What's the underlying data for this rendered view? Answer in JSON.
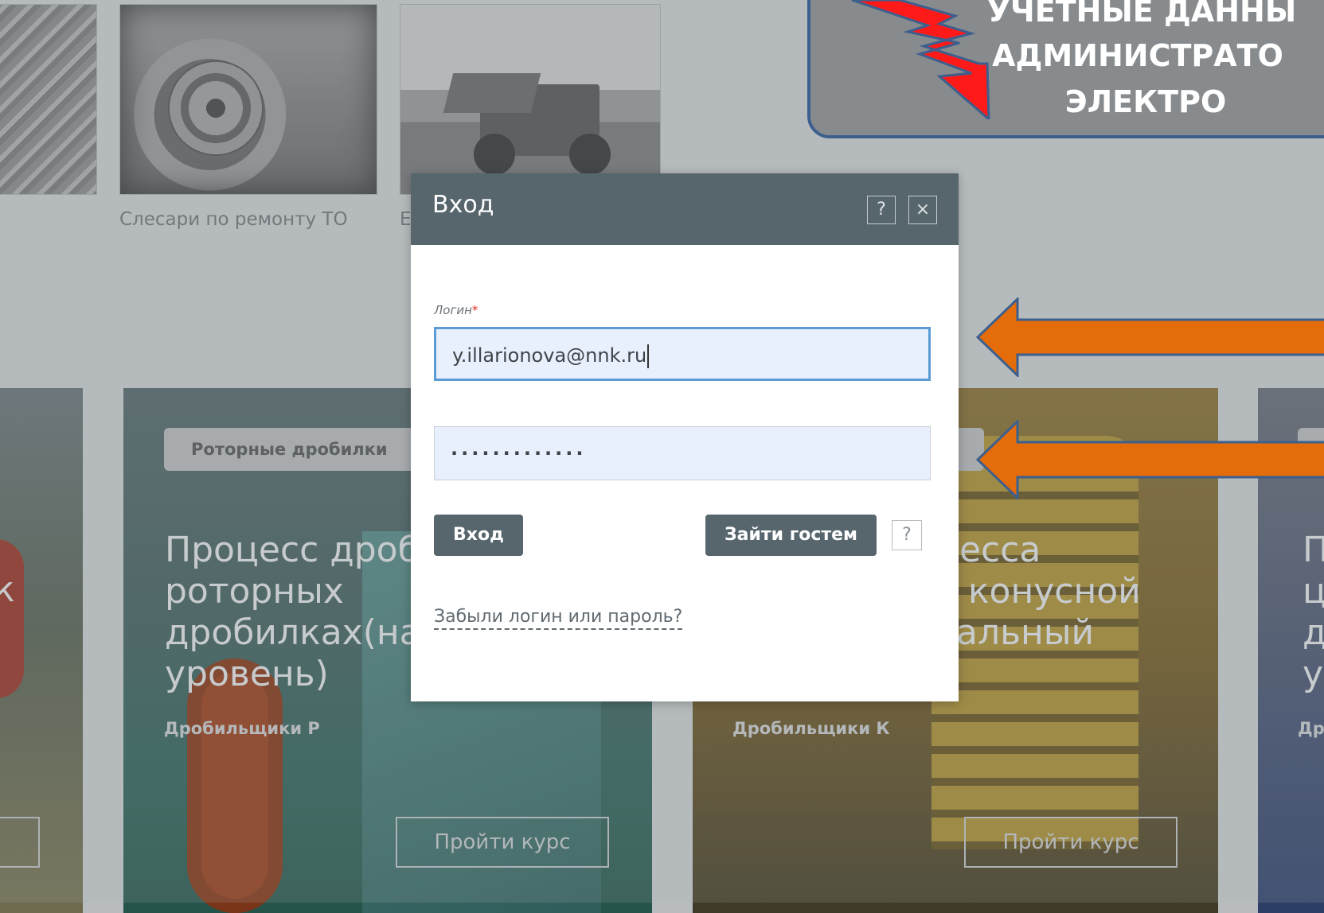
{
  "gallery": {
    "captions": [
      "Слесари по ремонту ТО",
      "Е"
    ]
  },
  "courses": [
    {
      "tag": "",
      "title_lines": [],
      "subtitle": "",
      "button": "",
      "fragment": "к"
    },
    {
      "tag": "Роторные дробилки",
      "title_lines": [
        "Процесс дроб",
        "роторных",
        "дробилках(нач",
        "уровень)"
      ],
      "subtitle": "Дробильщики Р",
      "button": "Пройти курс"
    },
    {
      "tag": "",
      "title_lines": [
        "цесса",
        "а конусной",
        "чальный"
      ],
      "subtitle": "Дробильщики К",
      "button": "Пройти курс"
    },
    {
      "tag": "",
      "title_lines": [
        "П",
        "ц",
        "д",
        "у"
      ],
      "subtitle": "Др",
      "button": ""
    }
  ],
  "callout": {
    "lines": [
      "УЧЕТНЫЕ ДАННЫ",
      "АДМИНИСТРАТО",
      "ЭЛЕКТРО"
    ],
    "colors": {
      "fill": "#878b8e",
      "border": "#3d5f8e",
      "bolt": "#ff1a1a",
      "arrow": "#e46c0a"
    }
  },
  "login_modal": {
    "title": "Вход",
    "help_icon": "?",
    "close_icon": "×",
    "login_label": "Логин",
    "required_mark": "*",
    "login_value": "y.illarionova@nnk.ru",
    "password_value": "·············",
    "enter_button": "Вход",
    "guest_button": "Зайти гостем",
    "guest_help_icon": "?",
    "forgot_link": "Забыли логин или пароль?"
  },
  "colors": {
    "header": "#56666c",
    "input_focus_border": "#5b9bd5",
    "input_bg": "#e8f0fe",
    "backdrop": "#b8bcbf"
  }
}
